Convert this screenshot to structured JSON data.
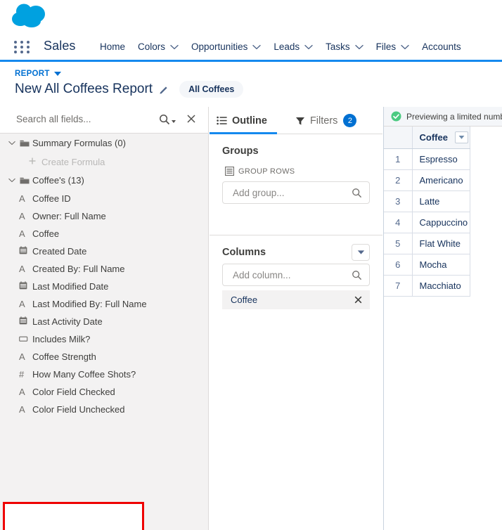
{
  "header": {
    "logo_icon": "salesforce-cloud-logo",
    "app_launcher_icon": "app-launcher-grid-icon",
    "app_name": "Sales",
    "nav_items": [
      {
        "label": "Home",
        "has_chevron": false
      },
      {
        "label": "Colors",
        "has_chevron": true
      },
      {
        "label": "Opportunities",
        "has_chevron": true
      },
      {
        "label": "Leads",
        "has_chevron": true
      },
      {
        "label": "Tasks",
        "has_chevron": true
      },
      {
        "label": "Files",
        "has_chevron": true
      },
      {
        "label": "Accounts",
        "has_chevron": false
      }
    ],
    "accent_color": "#1589ee"
  },
  "report": {
    "breadcrumb": "REPORT",
    "title": "New All Coffees Report",
    "edit_icon": "pencil-icon",
    "badge": "All Coffees"
  },
  "fields_panel": {
    "search": {
      "placeholder": "Search all fields...",
      "value": "",
      "icon": "search-icon",
      "close_icon": "close-icon"
    },
    "folders": [
      {
        "label": "Summary Formulas (0)",
        "expanded": true,
        "icon": "folder-icon"
      },
      {
        "label": "Coffee's (13)",
        "expanded": true,
        "icon": "folder-icon"
      }
    ],
    "create_formula": {
      "label": "Create Formula",
      "icon": "plus-icon"
    },
    "fields": [
      {
        "label": "Coffee ID",
        "type_icon": "text-field-icon",
        "glyph": "A"
      },
      {
        "label": "Owner: Full Name",
        "type_icon": "text-field-icon",
        "glyph": "A"
      },
      {
        "label": "Coffee",
        "type_icon": "text-field-icon",
        "glyph": "A"
      },
      {
        "label": "Created Date",
        "type_icon": "date-field-icon",
        "glyph": "calendar"
      },
      {
        "label": "Created By: Full Name",
        "type_icon": "text-field-icon",
        "glyph": "A"
      },
      {
        "label": "Last Modified Date",
        "type_icon": "date-field-icon",
        "glyph": "calendar"
      },
      {
        "label": "Last Modified By: Full Name",
        "type_icon": "text-field-icon",
        "glyph": "A"
      },
      {
        "label": "Last Activity Date",
        "type_icon": "date-field-icon",
        "glyph": "calendar"
      },
      {
        "label": "Includes Milk?",
        "type_icon": "checkbox-field-icon",
        "glyph": "checkbox"
      },
      {
        "label": "Coffee Strength",
        "type_icon": "text-field-icon",
        "glyph": "A"
      },
      {
        "label": "How Many Coffee Shots?",
        "type_icon": "number-field-icon",
        "glyph": "#"
      },
      {
        "label": "Color Field Checked",
        "type_icon": "text-field-icon",
        "glyph": "A"
      },
      {
        "label": "Color Field Unchecked",
        "type_icon": "text-field-icon",
        "glyph": "A"
      }
    ],
    "highlight": {
      "color": "#ee0000",
      "first_field": "Color Field Checked",
      "last_field": "Color Field Unchecked"
    }
  },
  "outline_panel": {
    "tabs": [
      {
        "label": "Outline",
        "icon": "outline-list-icon",
        "active": true
      },
      {
        "label": "Filters",
        "icon": "filter-funnel-icon",
        "active": false,
        "badge": "2"
      }
    ],
    "groups": {
      "title": "Groups",
      "sub_label": "GROUP ROWS",
      "sub_icon": "group-rows-icon",
      "add": {
        "placeholder": "Add group...",
        "value": "",
        "icon": "search-icon"
      }
    },
    "columns": {
      "title": "Columns",
      "menu_icon": "chevron-down-button-icon",
      "add": {
        "placeholder": "Add column...",
        "value": "",
        "icon": "search-icon"
      },
      "chips": [
        {
          "label": "Coffee",
          "remove_icon": "close-icon"
        }
      ]
    }
  },
  "preview_panel": {
    "banner": {
      "icon": "success-check-icon",
      "text": "Previewing a limited numb"
    },
    "table": {
      "columns": [
        "Coffee"
      ],
      "header_menu_icon": "chevron-down-icon",
      "rows": [
        {
          "index": "1",
          "Coffee": "Espresso"
        },
        {
          "index": "2",
          "Coffee": "Americano"
        },
        {
          "index": "3",
          "Coffee": "Latte"
        },
        {
          "index": "4",
          "Coffee": "Cappuccino"
        },
        {
          "index": "5",
          "Coffee": "Flat White"
        },
        {
          "index": "6",
          "Coffee": "Mocha"
        },
        {
          "index": "7",
          "Coffee": "Macchiato"
        }
      ]
    }
  }
}
